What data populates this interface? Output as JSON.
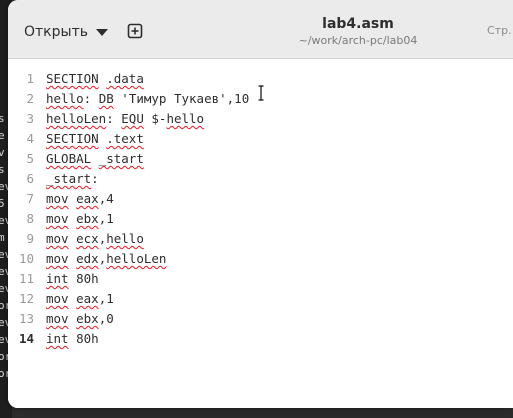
{
  "terminal": {
    "visible_fragments": [
      "s",
      "e",
      "v",
      "s",
      "ev",
      "5",
      "ev",
      "m",
      "ev",
      "ev",
      "ev",
      "or",
      "ev",
      "ev",
      "or",
      "or"
    ]
  },
  "header": {
    "open_label": "Открыть",
    "title": "lab4.asm",
    "subtitle": "~/work/arch-pc/lab04",
    "page_label": "Стр."
  },
  "icons": {
    "open_caret": "chevron-down-icon",
    "new_document": "add-document-icon",
    "text_cursor": "ibeam-cursor-icon"
  },
  "editor": {
    "active_line": 14,
    "lines": [
      {
        "n": "1",
        "segs": [
          {
            "t": "SECTION",
            "e": true
          },
          {
            "t": " "
          },
          {
            "t": ".data",
            "e": true
          }
        ]
      },
      {
        "n": "2",
        "segs": [
          {
            "t": "hello",
            "e": true
          },
          {
            "t": ": "
          },
          {
            "t": "DB",
            "e": true
          },
          {
            "t": " 'Тимур Тукаев',10"
          }
        ]
      },
      {
        "n": "3",
        "segs": [
          {
            "t": "helloLen",
            "e": true
          },
          {
            "t": ": "
          },
          {
            "t": "EQU",
            "e": true
          },
          {
            "t": " $-"
          },
          {
            "t": "hello",
            "e": true
          }
        ]
      },
      {
        "n": "4",
        "segs": [
          {
            "t": "SECTION",
            "e": true
          },
          {
            "t": " "
          },
          {
            "t": ".text",
            "e": true
          }
        ]
      },
      {
        "n": "5",
        "segs": [
          {
            "t": "GLOBAL",
            "e": true
          },
          {
            "t": " "
          },
          {
            "t": "_start",
            "e": true
          }
        ]
      },
      {
        "n": "6",
        "segs": [
          {
            "t": "_start",
            "e": true
          },
          {
            "t": ":"
          }
        ]
      },
      {
        "n": "7",
        "segs": [
          {
            "t": "mov",
            "e": true
          },
          {
            "t": " "
          },
          {
            "t": "eax",
            "e": true
          },
          {
            "t": ",4"
          }
        ]
      },
      {
        "n": "8",
        "segs": [
          {
            "t": "mov",
            "e": true
          },
          {
            "t": " "
          },
          {
            "t": "ebx",
            "e": true
          },
          {
            "t": ",1"
          }
        ]
      },
      {
        "n": "9",
        "segs": [
          {
            "t": "mov",
            "e": true
          },
          {
            "t": " "
          },
          {
            "t": "ecx",
            "e": true
          },
          {
            "t": ","
          },
          {
            "t": "hello",
            "e": true
          }
        ]
      },
      {
        "n": "10",
        "segs": [
          {
            "t": "mov",
            "e": true
          },
          {
            "t": " "
          },
          {
            "t": "edx",
            "e": true
          },
          {
            "t": ","
          },
          {
            "t": "helloLen",
            "e": true
          }
        ]
      },
      {
        "n": "11",
        "segs": [
          {
            "t": "int",
            "e": true
          },
          {
            "t": " 80h"
          }
        ]
      },
      {
        "n": "12",
        "segs": [
          {
            "t": "mov",
            "e": true
          },
          {
            "t": " "
          },
          {
            "t": "eax",
            "e": true
          },
          {
            "t": ",1"
          }
        ]
      },
      {
        "n": "13",
        "segs": [
          {
            "t": "mov",
            "e": true
          },
          {
            "t": " "
          },
          {
            "t": "ebx",
            "e": true
          },
          {
            "t": ",0"
          }
        ]
      },
      {
        "n": "14",
        "segs": [
          {
            "t": "int",
            "e": true
          },
          {
            "t": " 80h"
          }
        ]
      }
    ]
  }
}
